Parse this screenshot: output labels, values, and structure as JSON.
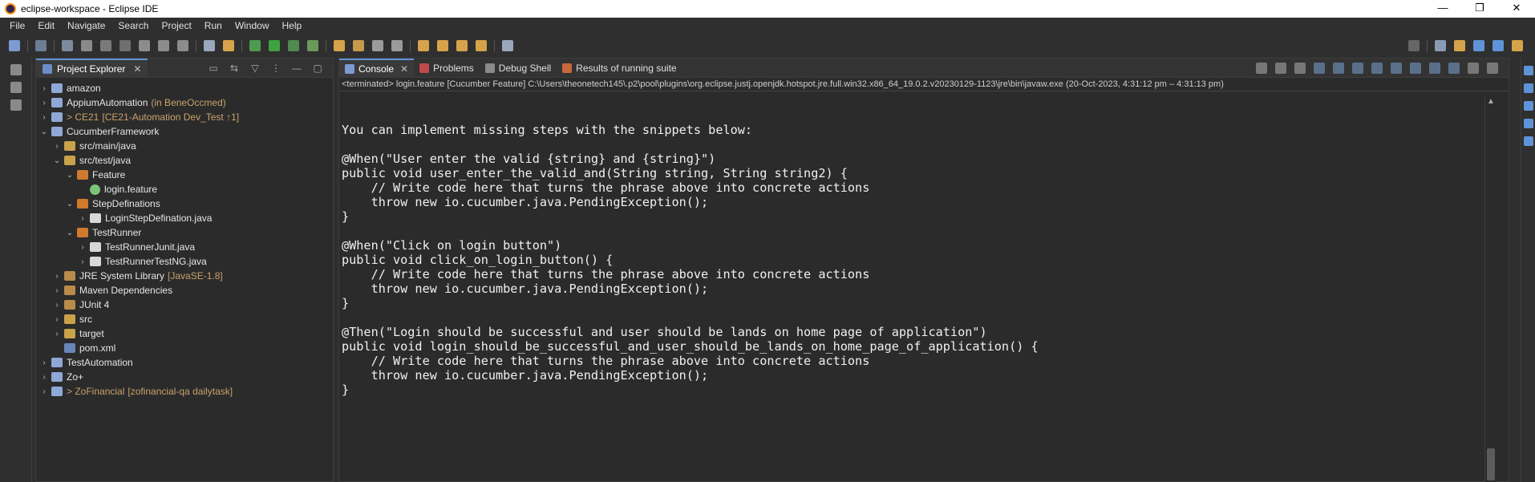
{
  "window": {
    "title": "eclipse-workspace - Eclipse IDE",
    "minimize_glyph": "—",
    "restore_glyph": "❐",
    "close_glyph": "✕"
  },
  "menu": [
    "File",
    "Edit",
    "Navigate",
    "Search",
    "Project",
    "Run",
    "Window",
    "Help"
  ],
  "explorer": {
    "tab_label": "Project Explorer",
    "close_glyph": "✕",
    "tree": [
      {
        "label": "amazon",
        "expanded": false,
        "indent": 0,
        "icon": "project-icon"
      },
      {
        "label": "AppiumAutomation",
        "deco": "(in BeneOccmed)",
        "expanded": false,
        "indent": 0,
        "icon": "project-icon"
      },
      {
        "label": "> CE21",
        "deco": "[CE21-Automation Dev_Test ↑1]",
        "git": true,
        "expanded": false,
        "indent": 0,
        "icon": "project-icon"
      },
      {
        "label": "CucumberFramework",
        "expanded": true,
        "indent": 0,
        "icon": "project-icon"
      },
      {
        "label": "src/main/java",
        "expanded": false,
        "indent": 1,
        "icon": "source-folder-icon"
      },
      {
        "label": "src/test/java",
        "expanded": true,
        "indent": 1,
        "icon": "source-folder-icon"
      },
      {
        "label": "Feature",
        "expanded": true,
        "indent": 2,
        "icon": "package-icon"
      },
      {
        "label": "login.feature",
        "expanded": null,
        "indent": 3,
        "icon": "feature-file-icon"
      },
      {
        "label": "StepDefinations",
        "expanded": true,
        "indent": 2,
        "icon": "package-icon"
      },
      {
        "label": "LoginStepDefination.java",
        "expanded": false,
        "indent": 3,
        "icon": "java-file-icon"
      },
      {
        "label": "TestRunner",
        "expanded": true,
        "indent": 2,
        "icon": "package-icon"
      },
      {
        "label": "TestRunnerJunit.java",
        "expanded": false,
        "indent": 3,
        "icon": "java-file-icon"
      },
      {
        "label": "TestRunnerTestNG.java",
        "expanded": false,
        "indent": 3,
        "icon": "java-file-icon"
      },
      {
        "label": "JRE System Library",
        "deco": "[JavaSE-1.8]",
        "expanded": false,
        "indent": 1,
        "icon": "library-icon"
      },
      {
        "label": "Maven Dependencies",
        "expanded": false,
        "indent": 1,
        "icon": "library-icon"
      },
      {
        "label": "JUnit 4",
        "expanded": false,
        "indent": 1,
        "icon": "library-icon"
      },
      {
        "label": "src",
        "expanded": false,
        "indent": 1,
        "icon": "folder-icon"
      },
      {
        "label": "target",
        "expanded": false,
        "indent": 1,
        "icon": "folder-icon"
      },
      {
        "label": "pom.xml",
        "expanded": null,
        "indent": 1,
        "icon": "xml-file-icon"
      },
      {
        "label": "TestAutomation",
        "expanded": false,
        "indent": 0,
        "icon": "project-icon"
      },
      {
        "label": "Zo+",
        "expanded": false,
        "indent": 0,
        "icon": "project-icon"
      },
      {
        "label": "> ZoFinancial",
        "deco": "[zofinancial-qa dailytask]",
        "git": true,
        "expanded": false,
        "indent": 0,
        "icon": "project-icon"
      }
    ]
  },
  "console": {
    "tabs": [
      {
        "label": "Console",
        "active": true,
        "icon": "console-icon"
      },
      {
        "label": "Problems",
        "active": false,
        "icon": "problems-icon"
      },
      {
        "label": "Debug Shell",
        "active": false,
        "icon": "debug-shell-icon"
      },
      {
        "label": "Results of running suite",
        "active": false,
        "icon": "testng-icon"
      }
    ],
    "close_glyph": "✕",
    "terminated_line": "<terminated> login.feature [Cucumber Feature] C:\\Users\\theonetech145\\.p2\\pool\\plugins\\org.eclipse.justj.openjdk.hotspot.jre.full.win32.x86_64_19.0.2.v20230129-1123\\jre\\bin\\javaw.exe  (20-Oct-2023, 4:31:12 pm – 4:31:13 pm)",
    "code_lines": [
      "",
      "You can implement missing steps with the snippets below:",
      "",
      "@When(\"User enter the valid {string} and {string}\")",
      "public void user_enter_the_valid_and(String string, String string2) {",
      "    // Write code here that turns the phrase above into concrete actions",
      "    throw new io.cucumber.java.PendingException();",
      "}",
      "",
      "@When(\"Click on login button\")",
      "public void click_on_login_button() {",
      "    // Write code here that turns the phrase above into concrete actions",
      "    throw new io.cucumber.java.PendingException();",
      "}",
      "",
      "@Then(\"Login should be successful and user should be lands on home page of application\")",
      "public void login_should_be_successful_and_user_should_be_lands_on_home_page_of_application() {",
      "    // Write code here that turns the phrase above into concrete actions",
      "    throw new io.cucumber.java.PendingException();",
      "}"
    ]
  },
  "colors": {
    "background": "#2f2f2f",
    "active_tab_accent": "#5f93d7",
    "decoration": "#c8a26b"
  }
}
